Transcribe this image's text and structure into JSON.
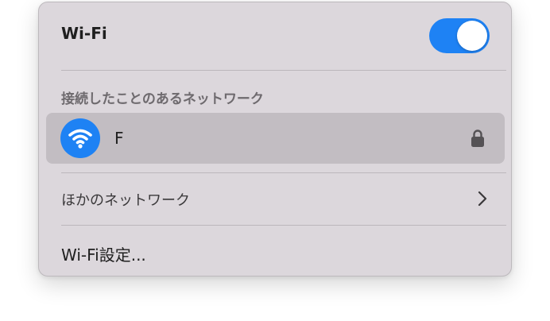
{
  "header": {
    "title": "Wi-Fi",
    "toggle_on": true,
    "toggle_color": "#1e82f4"
  },
  "known_networks": {
    "heading": "接続したことのあるネットワーク",
    "items": [
      {
        "name": "F",
        "icon": "wifi-icon",
        "secured": true,
        "lock_icon": "lock-icon"
      }
    ]
  },
  "other_networks": {
    "label": "ほかのネットワーク",
    "icon": "chevron-right-icon"
  },
  "settings": {
    "label": "Wi-Fi設定..."
  }
}
